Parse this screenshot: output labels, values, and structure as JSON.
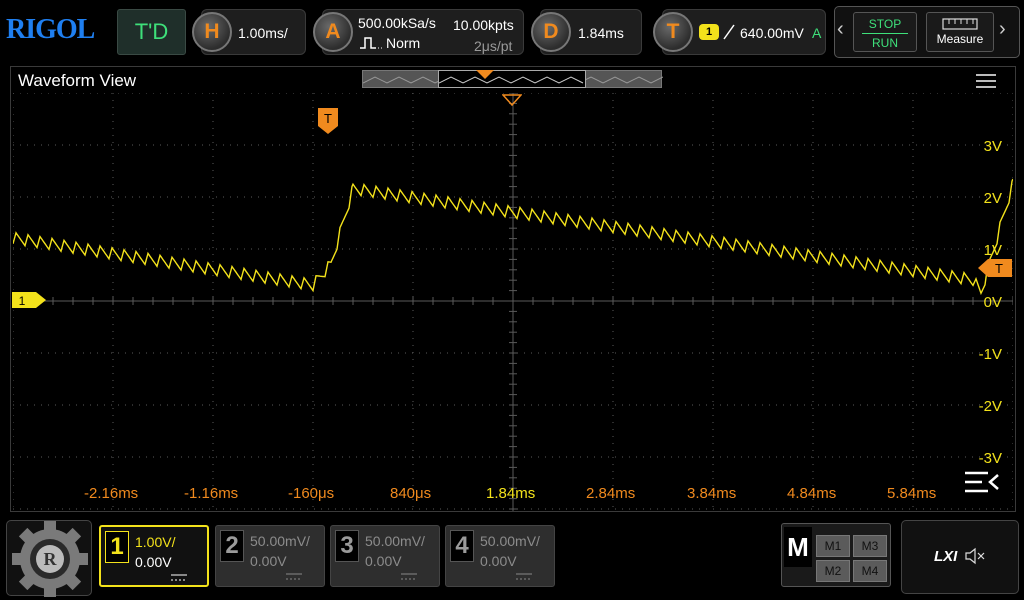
{
  "brand": {
    "logo": "RIGOL"
  },
  "top": {
    "mode": "T'D",
    "horizontal": {
      "key": "H",
      "timebase": "1.00ms/"
    },
    "acquire": {
      "key": "A",
      "sample_rate": "500.00kSa/s",
      "mem_depth": "10.00kpts",
      "mode": "Norm",
      "resolution": "2μs/pt"
    },
    "delay": {
      "key": "D",
      "value": "1.84ms"
    },
    "trigger": {
      "key": "T",
      "source": "1",
      "level": "640.00mV",
      "sweep": "A"
    },
    "run_stop": {
      "stop": "STOP",
      "run": "RUN"
    },
    "measure_label": "Measure",
    "left_arrow": "‹",
    "right_arrow": "›"
  },
  "waveform_view": {
    "title": "Waveform View",
    "channel_marker": "1",
    "trigger_marker": "T",
    "volt_labels": [
      "3V",
      "2V",
      "1V",
      "0V",
      "-1V",
      "-2V",
      "-3V"
    ],
    "time_labels": [
      "-2.16ms",
      "-1.16ms",
      "-160μs",
      "840μs",
      "1.84ms",
      "2.84ms",
      "3.84ms",
      "4.84ms",
      "5.84ms"
    ],
    "colors": {
      "trace": "#f3e21b",
      "grid": "#5a5a5a",
      "time_label": "#f08a1e",
      "trigger": "#f08a1e"
    }
  },
  "channels": [
    {
      "num": "1",
      "scale": "1.00V/",
      "offset": "0.00V",
      "active": true
    },
    {
      "num": "2",
      "scale": "50.00mV/",
      "offset": "0.00V",
      "active": false
    },
    {
      "num": "3",
      "scale": "50.00mV/",
      "offset": "0.00V",
      "active": false
    },
    {
      "num": "4",
      "scale": "50.00mV/",
      "offset": "0.00V",
      "active": false
    }
  ],
  "math": {
    "key": "M",
    "items": [
      "M1",
      "M3",
      "M2",
      "M4"
    ]
  },
  "lxi": {
    "label": "LXI"
  },
  "icons": {
    "gear": "gear-icon",
    "menu": "menu-icon",
    "collapse": "collapse-icon",
    "speaker": "speaker-muted-icon"
  }
}
